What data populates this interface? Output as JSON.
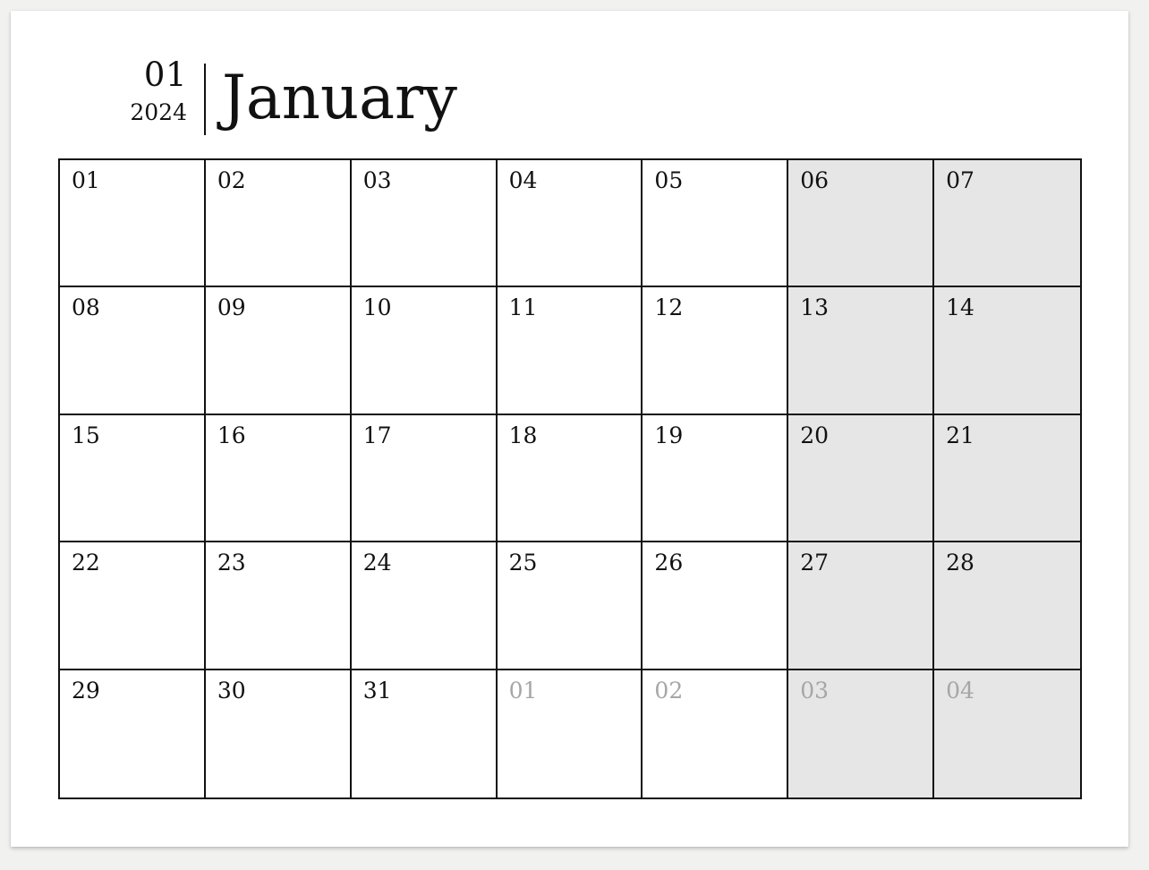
{
  "header": {
    "month_number": "01",
    "year": "2024",
    "month_name": "January"
  },
  "calendar": {
    "weeks": [
      [
        {
          "day": "01",
          "weekend": false,
          "other_month": false
        },
        {
          "day": "02",
          "weekend": false,
          "other_month": false
        },
        {
          "day": "03",
          "weekend": false,
          "other_month": false
        },
        {
          "day": "04",
          "weekend": false,
          "other_month": false
        },
        {
          "day": "05",
          "weekend": false,
          "other_month": false
        },
        {
          "day": "06",
          "weekend": true,
          "other_month": false
        },
        {
          "day": "07",
          "weekend": true,
          "other_month": false
        }
      ],
      [
        {
          "day": "08",
          "weekend": false,
          "other_month": false
        },
        {
          "day": "09",
          "weekend": false,
          "other_month": false
        },
        {
          "day": "10",
          "weekend": false,
          "other_month": false
        },
        {
          "day": "11",
          "weekend": false,
          "other_month": false
        },
        {
          "day": "12",
          "weekend": false,
          "other_month": false
        },
        {
          "day": "13",
          "weekend": true,
          "other_month": false
        },
        {
          "day": "14",
          "weekend": true,
          "other_month": false
        }
      ],
      [
        {
          "day": "15",
          "weekend": false,
          "other_month": false
        },
        {
          "day": "16",
          "weekend": false,
          "other_month": false
        },
        {
          "day": "17",
          "weekend": false,
          "other_month": false
        },
        {
          "day": "18",
          "weekend": false,
          "other_month": false
        },
        {
          "day": "19",
          "weekend": false,
          "other_month": false
        },
        {
          "day": "20",
          "weekend": true,
          "other_month": false
        },
        {
          "day": "21",
          "weekend": true,
          "other_month": false
        }
      ],
      [
        {
          "day": "22",
          "weekend": false,
          "other_month": false
        },
        {
          "day": "23",
          "weekend": false,
          "other_month": false
        },
        {
          "day": "24",
          "weekend": false,
          "other_month": false
        },
        {
          "day": "25",
          "weekend": false,
          "other_month": false
        },
        {
          "day": "26",
          "weekend": false,
          "other_month": false
        },
        {
          "day": "27",
          "weekend": true,
          "other_month": false
        },
        {
          "day": "28",
          "weekend": true,
          "other_month": false
        }
      ],
      [
        {
          "day": "29",
          "weekend": false,
          "other_month": false
        },
        {
          "day": "30",
          "weekend": false,
          "other_month": false
        },
        {
          "day": "31",
          "weekend": false,
          "other_month": false
        },
        {
          "day": "01",
          "weekend": false,
          "other_month": true
        },
        {
          "day": "02",
          "weekend": false,
          "other_month": true
        },
        {
          "day": "03",
          "weekend": true,
          "other_month": true
        },
        {
          "day": "04",
          "weekend": true,
          "other_month": true
        }
      ]
    ]
  },
  "colors": {
    "weekend_fill": "#e6e6e6",
    "other_month_text": "#a6a6a6",
    "grid_line": "#111111"
  }
}
